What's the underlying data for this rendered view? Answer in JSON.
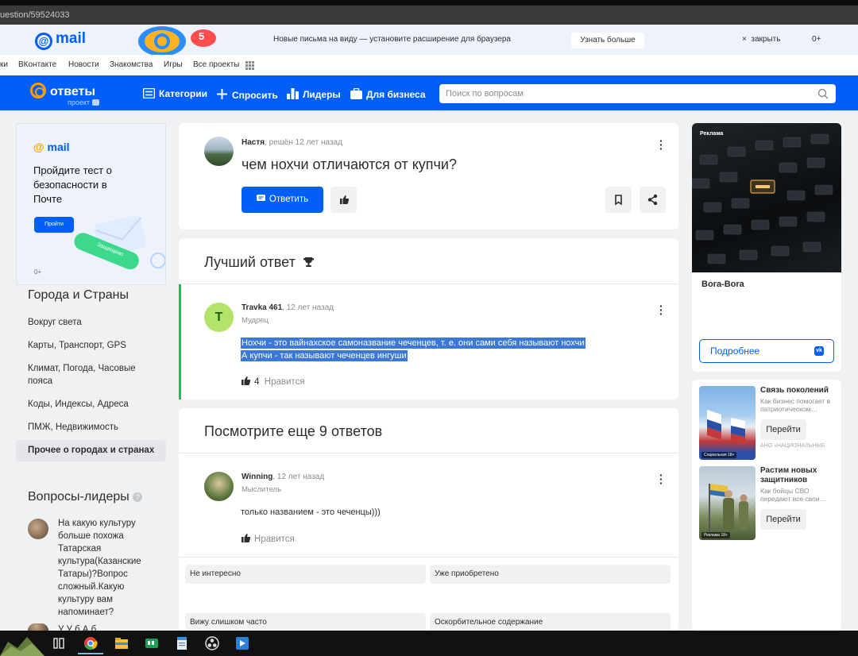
{
  "browser": {
    "url_fragment": "uestion/59524033"
  },
  "promo_bar": {
    "logo": "mail",
    "badge_number": "5",
    "text": "Новые письма на виду — установите расширение для браузера",
    "learn_more": "Узнать больше",
    "close_icon": "×",
    "close": "закрыть",
    "age": "0+"
  },
  "portal_nav": {
    "items": [
      "ки",
      "ВКонтакте",
      "Новости",
      "Знакомства",
      "Игры",
      "Все проекты"
    ]
  },
  "header": {
    "logo": "ответы",
    "logo_sub": "проект",
    "nav": [
      "Категории",
      "Спросить",
      "Лидеры",
      "Для бизнеса"
    ],
    "search_placeholder": "Поиск по вопросам"
  },
  "left_ad": {
    "logo": "mail",
    "text": "Пройдите тест о безопасности в Почте",
    "button": "Пройти",
    "shield_text": "Защищено",
    "age": "0+"
  },
  "categories": {
    "title": "Города и Страны",
    "items": [
      "Вокруг света",
      "Карты, Транспорт, GPS",
      "Климат, Погода, Часовые пояса",
      "Коды, Индексы, Адреса",
      "ПМЖ, Недвижимость"
    ],
    "active": "Прочее о городах и странах"
  },
  "leaders": {
    "title": "Вопросы-лидеры",
    "question": "На какую культуру больше похожа Татарская культура(Казанские Татары)?Вопрос сложный.Какую культуру вам напоминает?",
    "next_partial": "У У б              А   б"
  },
  "question": {
    "author": "Настя",
    "meta": ", решён 12 лет назад",
    "title": "чем нохчи отличаются от купчи?",
    "answer_button": "Ответить"
  },
  "best_answer": {
    "section_title": "Лучший ответ",
    "author": "Travka 461",
    "time": ", 12 лет назад",
    "rank": "Мудрец",
    "avatar_letter": "T",
    "text_line1": "Нохчи - это вайнахское самоназвание чеченцев, т. е. они сами себя называют нохчи",
    "text_line2": "А купчи - так называют чеченцев ингуши",
    "likes": "4",
    "like_label": "Нравится"
  },
  "more_answers": {
    "section_title": "Посмотрите еще 9 ответов",
    "author": "Winning",
    "time": ", 12 лет назад",
    "rank": "Мыслитель",
    "text": "только названием - это чеченцы)))",
    "like_label": "Нравится"
  },
  "feedback": [
    "Не интересно",
    "Уже приобретено",
    "Вижу слишком часто",
    "Оскорбительное содержание"
  ],
  "right_ad": {
    "label": "Реклама",
    "name": "Bora-Bora",
    "button": "Подробнее",
    "vk_badge": "vk"
  },
  "small_ads": [
    {
      "title": "Связь поколений",
      "desc": "Как бизнес помогает в патриотическом…",
      "button": "Перейти",
      "org": "АНО «НАЦИОНАЛЬНЫЕ",
      "tag": "Социальная 18+"
    },
    {
      "title": "Растим новых защитников",
      "desc": "Как бойцы СВО передают все свои…",
      "button": "Перейти",
      "org": "",
      "tag": "Реклама 18+"
    }
  ],
  "icons": {
    "taskbar": [
      "task-view-icon",
      "chrome-icon",
      "explorer-icon",
      "app-green-icon",
      "notepad-icon",
      "obs-icon",
      "media-icon"
    ]
  },
  "colors": {
    "brand_blue": "#005ff9",
    "accent_orange": "#ff9e00",
    "best_green": "#11c45a"
  }
}
